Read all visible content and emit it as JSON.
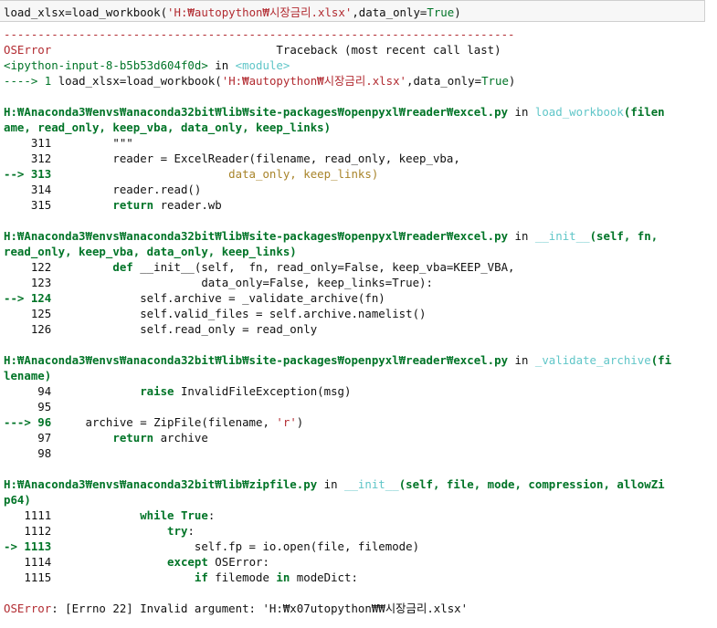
{
  "input_cell": {
    "code_prefix": "load_xlsx=load_workbook(",
    "code_str": "'H:₩autopython₩시장금리.xlsx'",
    "code_mid": ",data_only=",
    "code_true": "True",
    "code_end": ")"
  },
  "traceback": {
    "separator": "---------------------------------------------------------------------------",
    "error_type": "OSError",
    "header_right": "Traceback (most recent call last)",
    "input_ref": "<ipython-input-8-b5b53d604f0d>",
    "in_word": " in ",
    "module": "<module>",
    "line1_arrow": "----> 1 ",
    "line1_code_a": "load_xlsx=load_workbook(",
    "line1_code_str": "'H:₩autopython₩시장금리.xlsx'",
    "line1_code_b": ",data_only=",
    "line1_code_true": "True",
    "line1_code_c": ")",
    "frames": {
      "f1_path": "H:₩Anaconda3₩envs₩anaconda32bit₩lib₩site-packages₩openpyxl₩reader₩excel.py",
      "f1_func": "load_workbook",
      "f1_args1": "(filen",
      "f1_args2": "ame, read_only, keep_vba, data_only, keep_links)",
      "f1_l311": "    311         \"\"\"",
      "f1_l312": "    312         reader = ExcelReader(filename, read_only, keep_vba,",
      "f1_l313_arrow": "--> 313",
      "f1_l313_code": "                          data_only, keep_links)",
      "f1_l314": "    314         reader.read()",
      "f1_l315_num": "    315         ",
      "f1_l315_kw": "return",
      "f1_l315_rest": " reader.wb",
      "f2_path": "H:₩Anaconda3₩envs₩anaconda32bit₩lib₩site-packages₩openpyxl₩reader₩excel.py",
      "f2_func": "__init__",
      "f2_args1": "(self, fn,",
      "f2_args2": "read_only, keep_vba, data_only, keep_links)",
      "f2_l122_num": "    122         ",
      "f2_l122_kw": "def",
      "f2_l122_rest": " __init__(self,  fn, read_only=False, keep_vba=KEEP_VBA,",
      "f2_l123": "    123                      data_only=False, keep_links=True):",
      "f2_l124_arrow": "--> 124",
      "f2_l124_code": "             self.archive = _validate_archive(fn)",
      "f2_l125": "    125             self.valid_files = self.archive.namelist()",
      "f2_l126": "    126             self.read_only = read_only",
      "f3_path": "H:₩Anaconda3₩envs₩anaconda32bit₩lib₩site-packages₩openpyxl₩reader₩excel.py",
      "f3_func": "_validate_archive",
      "f3_args1": "(fi",
      "f3_args2": "lename)",
      "f3_l94_num": "     94             ",
      "f3_l94_kw": "raise",
      "f3_l94_rest": " InvalidFileException(msg)",
      "f3_l95": "     95",
      "f3_l96_arrow": "---> 96",
      "f3_l96_code": "     archive = ZipFile(filename, ",
      "f3_l96_str": "'r'",
      "f3_l96_end": ")",
      "f3_l97_num": "     97         ",
      "f3_l97_kw": "return",
      "f3_l97_rest": " archive",
      "f3_l98": "     98",
      "f4_path": "H:₩Anaconda3₩envs₩anaconda32bit₩lib₩zipfile.py",
      "f4_func": "__init__",
      "f4_args1": "(self, file, mode, compression, allowZi",
      "f4_args2": "p64)",
      "f4_l1111_num": "   1111             ",
      "f4_l1111_kw": "while True",
      "f4_l1111_end": ":",
      "f4_l1112_num": "   1112                 ",
      "f4_l1112_kw": "try",
      "f4_l1112_end": ":",
      "f4_l1113_arrow": "-> 1113",
      "f4_l1113_code": "                     self.fp = io.open(file, filemode)",
      "f4_l1114_num": "   1114                 ",
      "f4_l1114_kw": "except",
      "f4_l1114_rest": " OSError:",
      "f4_l1115_num": "   1115                     ",
      "f4_l1115_kw": "if",
      "f4_l1115_mid": " filemode ",
      "f4_l1115_kw2": "in",
      "f4_l1115_rest": " modeDict:"
    },
    "final_error_type": "OSError",
    "final_error_msg": ": [Errno 22] Invalid argument: 'H:₩x07utopython₩₩시장금리.xlsx'"
  },
  "colors": {
    "error_red": "#b22b31",
    "path_green": "#007427",
    "func_cyan": "#60c6c8",
    "code_brown": "#a8842a"
  }
}
